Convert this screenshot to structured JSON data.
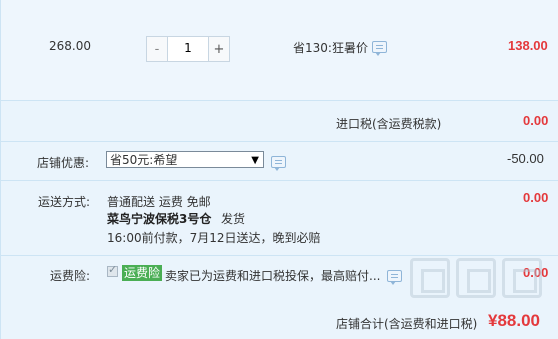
{
  "item": {
    "unit_price": "268.00",
    "quantity": "1",
    "minus_label": "-",
    "plus_label": "+",
    "promo_text": "省130:狂暑价",
    "subtotal": "138.00"
  },
  "import_tax": {
    "label": "进口税(含运费税款)",
    "value": "0.00"
  },
  "store_discount": {
    "label": "店铺优惠:",
    "selected": "省50元:希望",
    "value": "-50.00"
  },
  "shipping": {
    "label": "运送方式:",
    "method": "普通配送 运费 免邮",
    "warehouse": "菜鸟宁波保税3号仓",
    "dispatch": "发货",
    "eta": "16:00前付款，7月12日送达，晚到必赔",
    "value": "0.00"
  },
  "freight_insurance": {
    "label": "运费险:",
    "badge": "运费险",
    "description": "卖家已为运费和进口税投保，最高赔付...",
    "value": "0.00"
  },
  "total": {
    "label": "店铺合计(含运费和进口税)",
    "value": "¥88.00"
  },
  "colors": {
    "price_red": "#e4393c",
    "background": "#eaf4fc",
    "badge_green": "#4aae54"
  },
  "icons": [
    "chat-icon",
    "dropdown-arrow-icon",
    "check-icon",
    "watermark-logo"
  ]
}
